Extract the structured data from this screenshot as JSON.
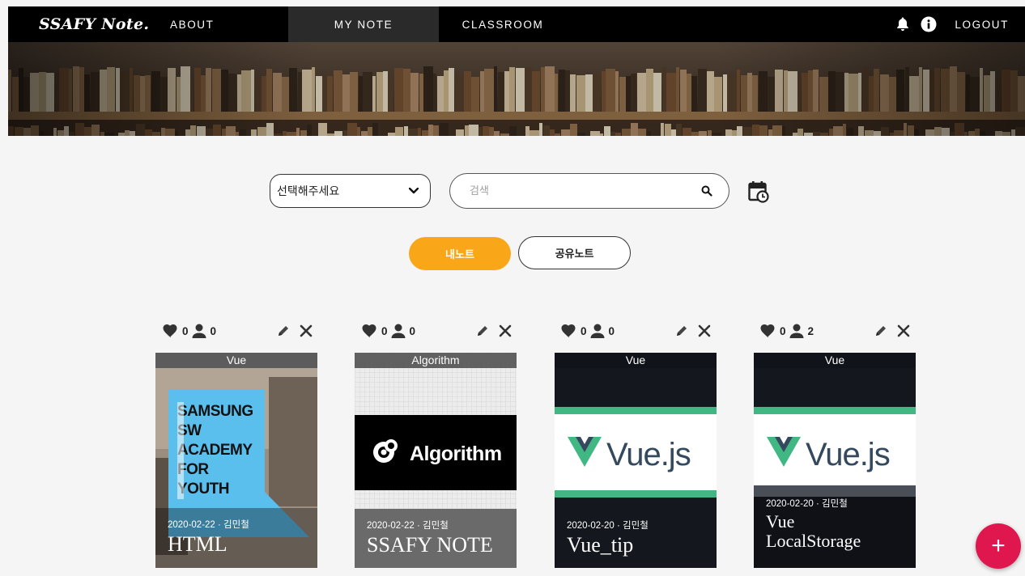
{
  "nav": {
    "brand": "SSAFY Note.",
    "about": "ABOUT",
    "my_note": "MY NOTE",
    "classroom": "CLASSROOM",
    "logout": "LOGOUT"
  },
  "filters": {
    "select_value": "선택해주세요",
    "search_placeholder": "검색"
  },
  "tabs": {
    "mine": "내노트",
    "shared": "공유노트"
  },
  "notes": [
    {
      "tag": "Vue",
      "likes": "0",
      "members": "0",
      "date": "2020-02-22 · 김민철",
      "title": "HTML",
      "cover_lines": [
        "SAMSUNG",
        "SW",
        "ACADEMY",
        "FOR",
        "YOUTH"
      ]
    },
    {
      "tag": "Algorithm",
      "likes": "0",
      "members": "0",
      "date": "2020-02-22 · 김민철",
      "title": "SSAFY NOTE",
      "cover_text": "Algorithm"
    },
    {
      "tag": "Vue",
      "likes": "0",
      "members": "0",
      "date": "2020-02-20 · 김민철",
      "title": "Vue_tip",
      "cover_text": "Vue.js"
    },
    {
      "tag": "Vue",
      "likes": "0",
      "members": "2",
      "date": "2020-02-20 · 김민철",
      "title_line1": "Vue",
      "title_line2": "LocalStorage",
      "cover_text": "Vue.js"
    }
  ],
  "fab_label": "+",
  "colors": {
    "accent": "#f9a619",
    "fab": "#e0174f",
    "vue_green": "#41b883",
    "vue_dark": "#34495e",
    "ssafy_blue": "#5bbfee"
  }
}
